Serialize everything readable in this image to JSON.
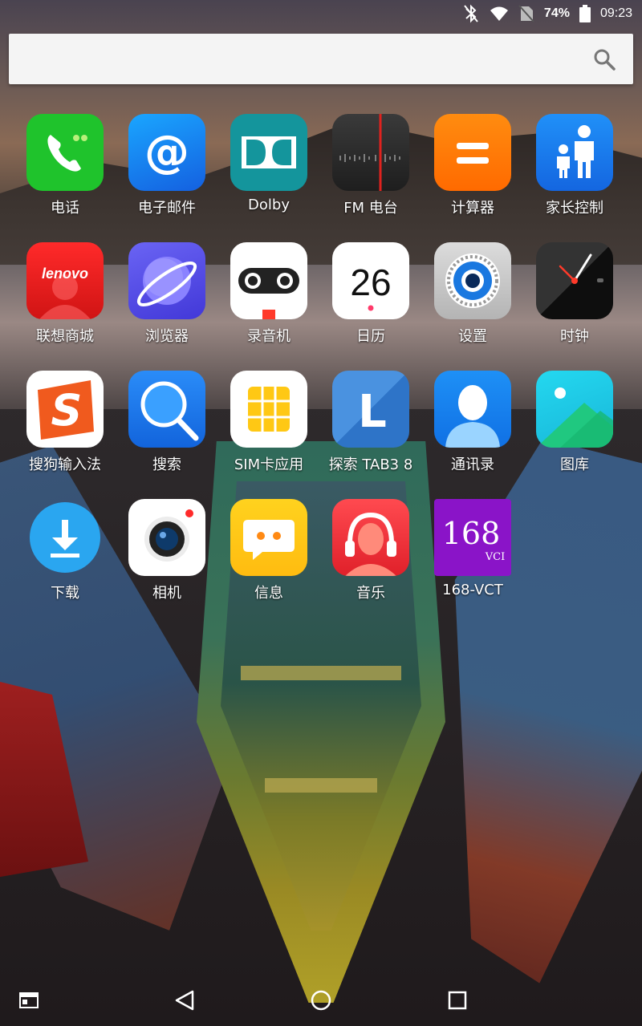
{
  "status_bar": {
    "bluetooth_icon": "bluetooth-icon",
    "wifi_icon": "wifi-icon",
    "no_sim_icon": "no-sim-icon",
    "battery_percent": "74%",
    "battery_icon": "battery-icon",
    "battery_level": 0.74,
    "time": "09:23"
  },
  "search": {
    "value": "",
    "placeholder": "",
    "icon": "search-icon"
  },
  "apps": [
    {
      "label": "电话"
    },
    {
      "label": "电子邮件"
    },
    {
      "label": "Dolby"
    },
    {
      "label": "FM 电台"
    },
    {
      "label": "计算器"
    },
    {
      "label": "家长控制"
    },
    {
      "label": "联想商城",
      "icon_text": "lenovo"
    },
    {
      "label": "浏览器"
    },
    {
      "label": "录音机"
    },
    {
      "label": "日历",
      "icon_text": "26"
    },
    {
      "label": "设置"
    },
    {
      "label": "时钟"
    },
    {
      "label": "搜狗输入法"
    },
    {
      "label": "搜索"
    },
    {
      "label": "SIM卡应用"
    },
    {
      "label": "探索 TAB3 8",
      "icon_text": "L"
    },
    {
      "label": "通讯录"
    },
    {
      "label": "图库"
    },
    {
      "label": "下载"
    },
    {
      "label": "相机"
    },
    {
      "label": "信息"
    },
    {
      "label": "音乐"
    },
    {
      "label": "168-VCT",
      "icon_text": "168",
      "icon_subtext": "VCI"
    }
  ],
  "nav": {
    "recents_alt_icon": "window-icon",
    "back_icon": "back-triangle-icon",
    "home_icon": "home-circle-icon",
    "overview_icon": "overview-square-icon"
  },
  "colors": {
    "phone": "#1fc32c",
    "email": "#1a7cf0",
    "dolby": "#14959c",
    "fm": "#2a2a2a",
    "calculator": "#ff7a08",
    "parental": "#1e80f0",
    "lenovo": "#e02020",
    "browser": "#5a52e8",
    "recorder": "#ffffff",
    "calendar": "#ffffff",
    "settings": "#c9c9c9",
    "clock": "#1a1a1a",
    "sogou": "#ffffff",
    "search": "#1a80ee",
    "sim": "#ffffff",
    "explore": "#3c86d6",
    "contacts": "#1684ee",
    "gallery": "#22cbe8",
    "download": "#2aa6f0",
    "camera": "#ffffff",
    "messages": "#ffc81a",
    "music": "#f2343c",
    "vct": "#8a14c8"
  }
}
